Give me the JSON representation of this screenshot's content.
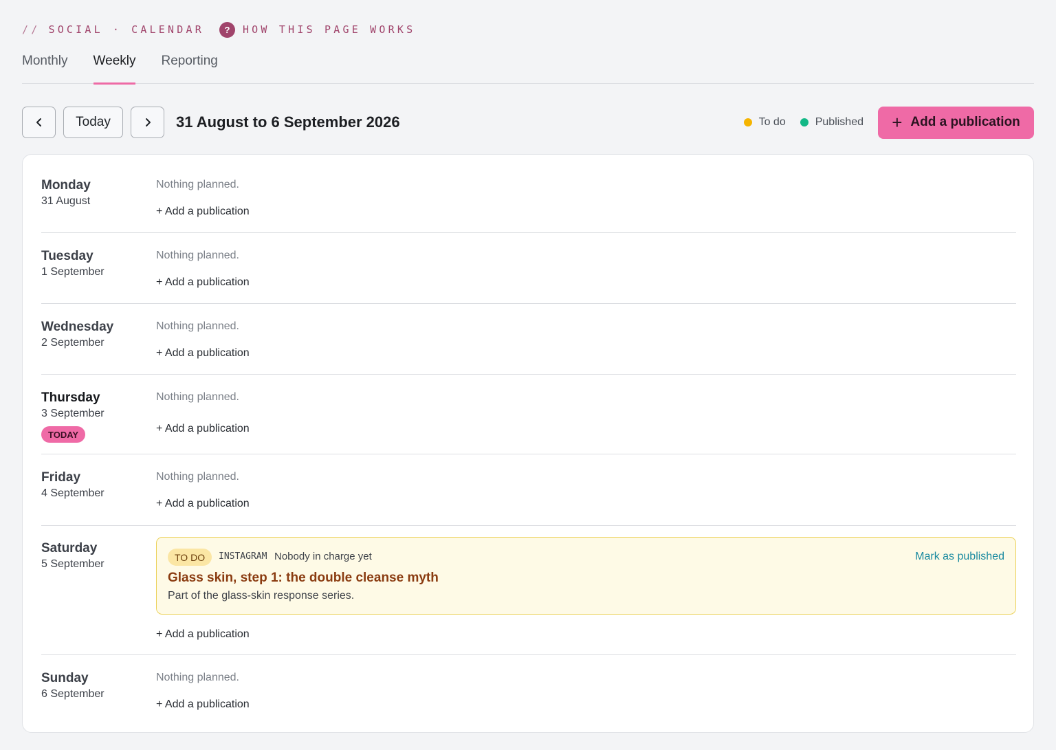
{
  "header": {
    "slashes": "//",
    "app_name": "SOCIAL",
    "separator": "·",
    "section": "CALENDAR",
    "help_icon": "?",
    "help_label": "HOW THIS PAGE WORKS"
  },
  "tabs": [
    {
      "label": "Monthly",
      "active": false
    },
    {
      "label": "Weekly",
      "active": true
    },
    {
      "label": "Reporting",
      "active": false
    }
  ],
  "toolbar": {
    "prev_icon": "chevron-left-icon",
    "today_label": "Today",
    "next_icon": "chevron-right-icon",
    "range": "31 August to 6 September 2026",
    "legend": [
      {
        "label": "To do",
        "color": "#f5b400"
      },
      {
        "label": "Published",
        "color": "#12b886"
      }
    ],
    "add_icon": "+",
    "add_label": "Add a publication"
  },
  "days": [
    {
      "name": "Monday",
      "date": "31 August",
      "nothing": "Nothing planned.",
      "add": "+ Add a publication"
    },
    {
      "name": "Tuesday",
      "date": "1 September",
      "nothing": "Nothing planned.",
      "add": "+ Add a publication"
    },
    {
      "name": "Wednesday",
      "date": "2 September",
      "nothing": "Nothing planned.",
      "add": "+ Add a publication"
    },
    {
      "name": "Thursday",
      "date": "3 September",
      "today_badge": "TODAY",
      "nothing": "Nothing planned.",
      "add": "+ Add a publication"
    },
    {
      "name": "Friday",
      "date": "4 September",
      "nothing": "Nothing planned.",
      "add": "+ Add a publication"
    },
    {
      "name": "Saturday",
      "date": "5 September",
      "add": "+ Add a publication",
      "publication": {
        "status": "TO DO",
        "network": "INSTAGRAM",
        "owner": "Nobody in charge yet",
        "action": "Mark as published",
        "title": "Glass skin, step 1: the double cleanse myth",
        "description": "Part of the glass-skin response series."
      }
    },
    {
      "name": "Sunday",
      "date": "6 September",
      "nothing": "Nothing planned.",
      "add": "+ Add a publication"
    }
  ]
}
